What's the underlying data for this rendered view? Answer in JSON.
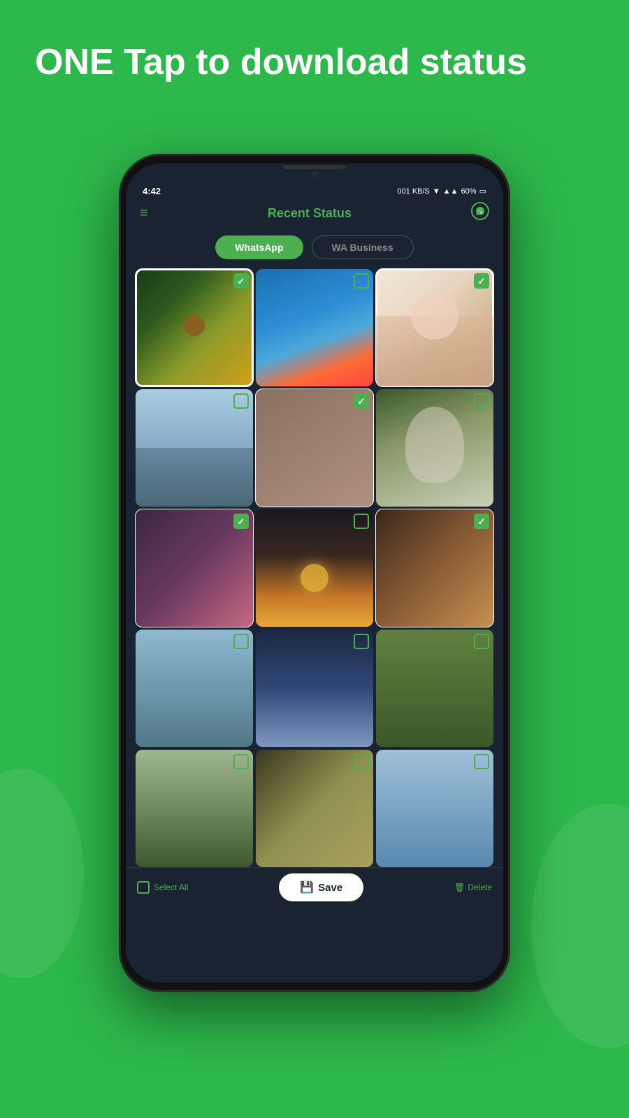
{
  "headline": "ONE Tap to download status",
  "background_color": "#2db84b",
  "status_bar": {
    "time": "4:42",
    "battery": "60%",
    "icons": "▼◀ ▲ 4G"
  },
  "app_header": {
    "title": "Recent Status",
    "menu_icon": "≡",
    "wa_icon": "●"
  },
  "tabs": [
    {
      "label": "WhatsApp",
      "active": true
    },
    {
      "label": "WA Business",
      "active": false
    }
  ],
  "photos": [
    {
      "id": 1,
      "type": "sunflower",
      "checked": true,
      "selected": true
    },
    {
      "id": 2,
      "type": "rainbow",
      "checked": false,
      "selected": false
    },
    {
      "id": 3,
      "type": "baby",
      "checked": true,
      "selected": true
    },
    {
      "id": 4,
      "type": "lake",
      "checked": false,
      "selected": false
    },
    {
      "id": 5,
      "type": "yoga",
      "checked": true,
      "selected": true
    },
    {
      "id": 6,
      "type": "woman",
      "checked": false,
      "selected": false
    },
    {
      "id": 7,
      "type": "art",
      "checked": true,
      "selected": true
    },
    {
      "id": 8,
      "type": "sunset",
      "checked": false,
      "selected": false
    },
    {
      "id": 9,
      "type": "rose",
      "checked": true,
      "selected": true
    },
    {
      "id": 10,
      "type": "stones",
      "checked": false,
      "selected": false
    },
    {
      "id": 11,
      "type": "city",
      "checked": false,
      "selected": false
    },
    {
      "id": 12,
      "type": "forest",
      "checked": false,
      "selected": false
    },
    {
      "id": 13,
      "type": "twins",
      "checked": false,
      "selected": false
    },
    {
      "id": 14,
      "type": "food",
      "checked": false,
      "selected": false
    },
    {
      "id": 15,
      "type": "girl",
      "checked": false,
      "selected": false
    }
  ],
  "bottom_bar": {
    "select_all_label": "Select All",
    "save_label": "Save",
    "delete_label": "Delete"
  }
}
